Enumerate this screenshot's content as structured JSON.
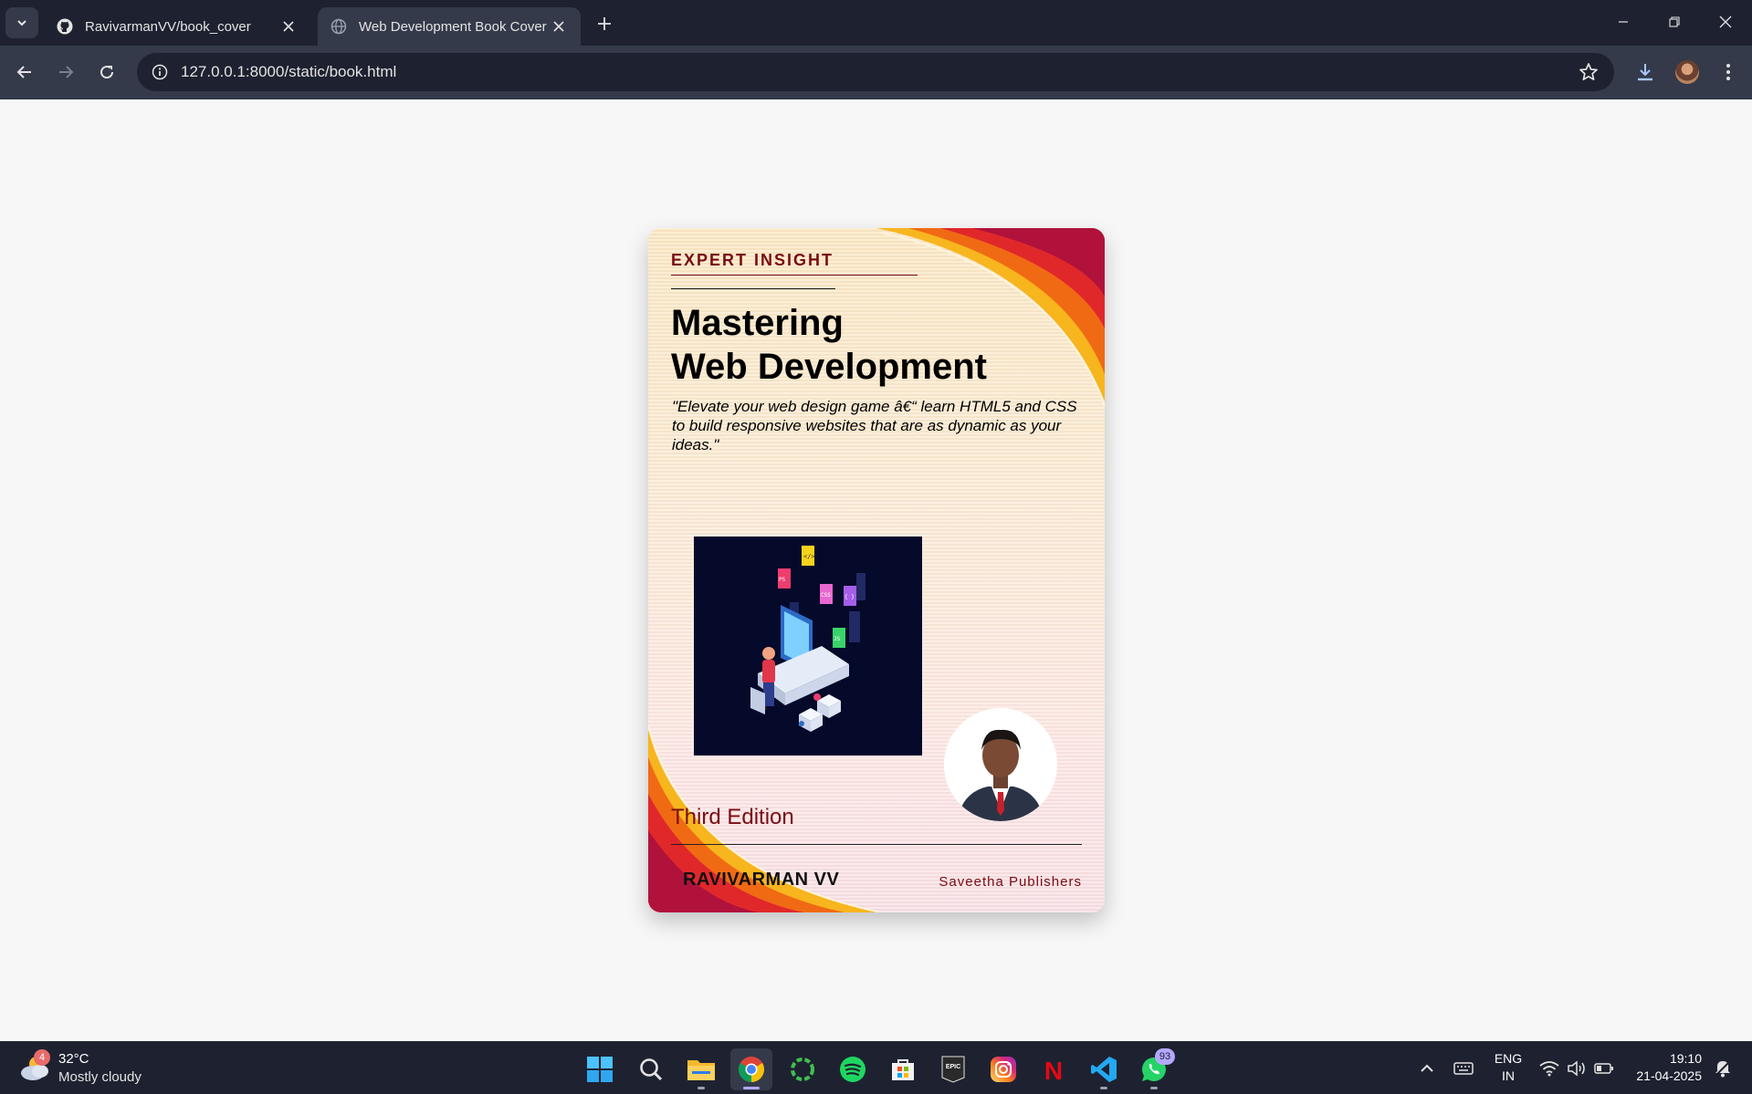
{
  "browser": {
    "tabs": [
      {
        "title": "RavivarmanVV/book_cover",
        "icon": "github-icon",
        "active": false
      },
      {
        "title": "Web Development Book Cover",
        "icon": "globe-icon",
        "active": true
      }
    ],
    "url": "127.0.0.1:8000/static/book.html"
  },
  "book": {
    "series": "EXPERT INSIGHT",
    "title_line1": "Mastering",
    "title_line2": "Web Development",
    "tagline": "\"Elevate your web design game â€“ learn HTML5 and CSS to build responsive websites that are as dynamic as your ideas.\"",
    "illustration_labels": [
      "</>",
      "JS",
      "CSS",
      "{ }",
      "</>",
      "PS"
    ],
    "edition": "Third Edition",
    "author": "RAVIVARMAN VV",
    "publisher": "Saveetha Publishers",
    "colors": {
      "accent": "#7a0b12",
      "swoosh_outer": "#b0123c",
      "swoosh_orange": "#f06a14",
      "swoosh_yellow": "#f7b51e",
      "illustration_bg": "#05092a"
    }
  },
  "taskbar": {
    "weather": {
      "badge": "4",
      "temp": "32°C",
      "condition": "Mostly cloudy"
    },
    "apps": [
      {
        "name": "start-icon"
      },
      {
        "name": "search-icon"
      },
      {
        "name": "file-explorer-icon"
      },
      {
        "name": "chrome-icon"
      },
      {
        "name": "ring-app-icon"
      },
      {
        "name": "spotify-icon"
      },
      {
        "name": "microsoft-store-icon"
      },
      {
        "name": "epic-games-icon",
        "label": "EPIC"
      },
      {
        "name": "instagram-icon"
      },
      {
        "name": "netflix-icon",
        "label": "N"
      },
      {
        "name": "vscode-icon"
      },
      {
        "name": "whatsapp-icon",
        "badge": "93"
      }
    ],
    "lang_line1": "ENG",
    "lang_line2": "IN",
    "time": "19:10",
    "date": "21-04-2025"
  }
}
